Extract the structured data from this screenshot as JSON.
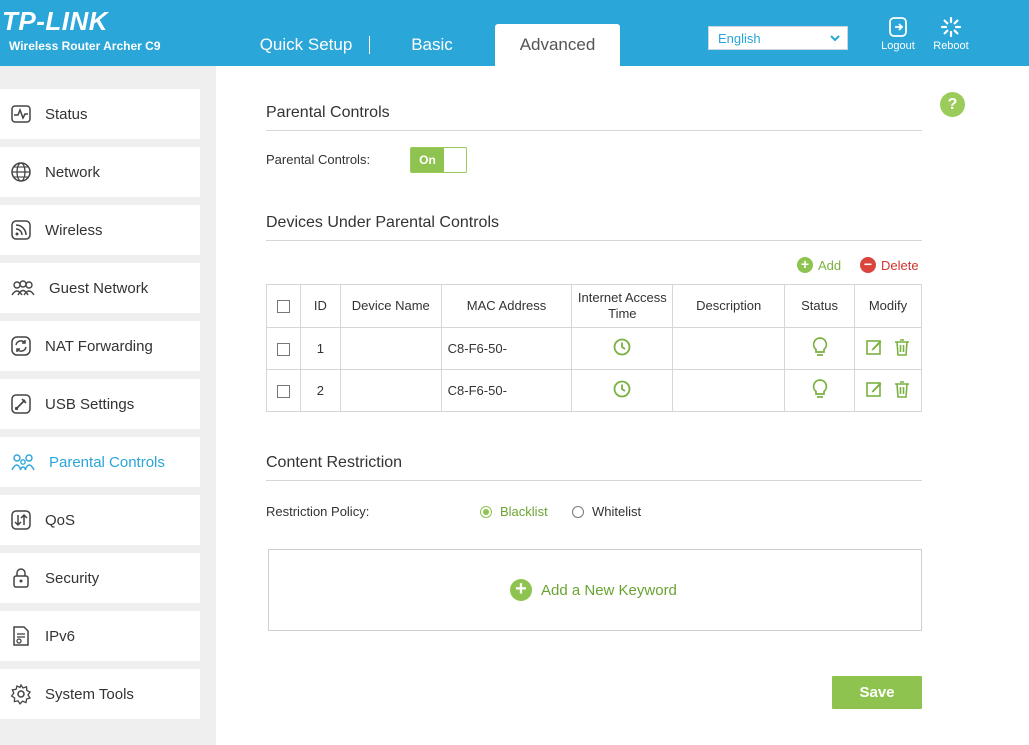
{
  "header": {
    "logo": "TP-LINK",
    "model": "Wireless Router Archer C9",
    "tabs": [
      {
        "label": "Quick Setup"
      },
      {
        "label": "Basic"
      },
      {
        "label": "Advanced",
        "active": true
      }
    ],
    "language": "English",
    "logout_label": "Logout",
    "reboot_label": "Reboot"
  },
  "sidebar": {
    "items": [
      {
        "label": "Status",
        "icon": "pulse-icon"
      },
      {
        "label": "Network",
        "icon": "globe-icon"
      },
      {
        "label": "Wireless",
        "icon": "wifi-icon"
      },
      {
        "label": "Guest Network",
        "icon": "users-icon"
      },
      {
        "label": "NAT Forwarding",
        "icon": "refresh-icon"
      },
      {
        "label": "USB Settings",
        "icon": "usb-icon"
      },
      {
        "label": "Parental Controls",
        "icon": "family-icon",
        "active": true
      },
      {
        "label": "QoS",
        "icon": "qos-icon"
      },
      {
        "label": "Security",
        "icon": "lock-icon"
      },
      {
        "label": "IPv6",
        "icon": "document-icon"
      },
      {
        "label": "System Tools",
        "icon": "gear-icon"
      }
    ]
  },
  "main": {
    "help": "?",
    "parental": {
      "title": "Parental Controls",
      "label": "Parental Controls:",
      "toggle": "On"
    },
    "devices": {
      "title": "Devices Under Parental Controls",
      "add_label": "Add",
      "delete_label": "Delete",
      "columns": [
        "ID",
        "Device Name",
        "MAC Address",
        "Internet Access Time",
        "Description",
        "Status",
        "Modify"
      ],
      "rows": [
        {
          "id": "1",
          "name": "",
          "mac": "C8-F6-50-"
        },
        {
          "id": "2",
          "name": "",
          "mac": "C8-F6-50-"
        }
      ]
    },
    "content": {
      "title": "Content Restriction",
      "policy_label": "Restriction Policy:",
      "blacklist": "Blacklist",
      "whitelist": "Whitelist",
      "selected": "Blacklist",
      "add_keyword": "Add a New Keyword"
    },
    "save_label": "Save"
  },
  "colors": {
    "header_blue": "#2aa6d8",
    "accent_green": "#8fc34f",
    "delete_red": "#d9453c"
  }
}
